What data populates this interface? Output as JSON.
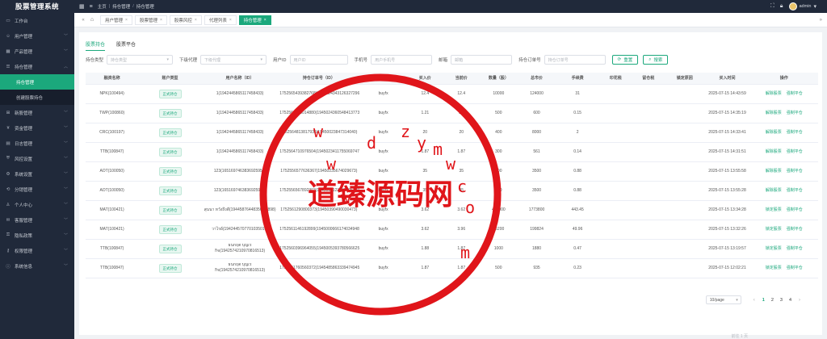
{
  "app": {
    "title": "股票管理系统"
  },
  "topbar": {
    "breadcrumb": [
      "主页",
      "持仓管理",
      "持仓管理"
    ],
    "user": "admin"
  },
  "sidebar": {
    "items": [
      {
        "label": "工作台",
        "icon": "monitor-icon",
        "chevron": false
      },
      {
        "label": "用户管理",
        "icon": "user-icon",
        "chevron": true
      },
      {
        "label": "产品管理",
        "icon": "grid-icon",
        "chevron": true
      },
      {
        "label": "持仓管理",
        "icon": "list-icon",
        "chevron": true,
        "expanded": true
      }
    ],
    "sub_items": [
      {
        "label": "持仓管理",
        "active": true
      },
      {
        "label": "创建股票持仓",
        "active": false
      }
    ],
    "items_after": [
      {
        "label": "新股管理",
        "icon": "plus-square-icon"
      },
      {
        "label": "资金管理",
        "icon": "money-icon"
      },
      {
        "label": "日志管理",
        "icon": "doc-icon"
      },
      {
        "label": "风控设置",
        "icon": "shield-icon"
      },
      {
        "label": "系统设置",
        "icon": "gear-icon"
      },
      {
        "label": "分销管理",
        "icon": "share-icon"
      },
      {
        "label": "个人中心",
        "icon": "person-icon"
      },
      {
        "label": "客服管理",
        "icon": "chat-icon"
      },
      {
        "label": "隐私政策",
        "icon": "lock-icon"
      },
      {
        "label": "权限管理",
        "icon": "key-icon"
      },
      {
        "label": "系统信息",
        "icon": "info-icon"
      }
    ]
  },
  "tabs": [
    {
      "label": "用户管理",
      "active": false
    },
    {
      "label": "股票管理",
      "active": false
    },
    {
      "label": "股票风控",
      "active": false
    },
    {
      "label": "代理列表",
      "active": false
    },
    {
      "label": "持仓管理",
      "active": true
    }
  ],
  "subtabs": [
    {
      "label": "股票持仓",
      "active": true
    },
    {
      "label": "股票平仓",
      "active": false
    }
  ],
  "filters": [
    {
      "label": "持仓类型",
      "placeholder": "持仓类型",
      "select": true,
      "width": 82
    },
    {
      "label": "下级代理",
      "placeholder": "下级代理",
      "select": true,
      "width": 82
    },
    {
      "label": "用户ID",
      "placeholder": "用户ID",
      "select": false,
      "width": 72
    },
    {
      "label": "手机号",
      "placeholder": "用户手机号",
      "select": false,
      "width": 76
    },
    {
      "label": "邮箱",
      "placeholder": "邮箱",
      "select": false,
      "width": 76
    },
    {
      "label": "持仓订单号",
      "placeholder": "持仓订单号",
      "select": false,
      "width": 76
    }
  ],
  "buttons": {
    "reset": "重置",
    "search": "搜索"
  },
  "table": {
    "headers": [
      "融资名称",
      "账户类型",
      "用户名称（ID）",
      "持仓订单号（ID）",
      "买卖方向",
      "买入价",
      "当前价",
      "数量（股）",
      "总市价",
      "手续费",
      "印花税",
      "留仓税",
      "锁定原因",
      "买入时间",
      "操作"
    ],
    "rows": [
      [
        "NPK(100494)",
        "正式持仓",
        "1(1942445865117458433)",
        "1752565439382768(19450243431263272962)",
        "buyfx",
        "12.4",
        "12.4",
        "10000",
        "124000",
        "31",
        "",
        "",
        "",
        "2025-07-15 14:43:59"
      ],
      [
        "TWP(100860)",
        "正式持仓",
        "1(1942445865117458433)",
        "1752564919014880(19450243605484137730)",
        "buyfx",
        "1.21",
        "1.2",
        "500",
        "600",
        "0.15",
        "",
        "",
        "",
        "2025-07-15 14:35:19"
      ],
      [
        "CRC(100197)",
        "正式持仓",
        "1(1942445865117458433)",
        "1752564813817936(19450023847314040)",
        "buyfx",
        "20",
        "20",
        "400",
        "8000",
        "2",
        "",
        "",
        "",
        "2025-07-15 14:33:41"
      ],
      [
        "TTB(100847)",
        "正式持仓",
        "1(1942445865117458433)",
        "1752564710976504(19450234117550697473)",
        "buyfx",
        "1.87",
        "1.87",
        "300",
        "561",
        "0.14",
        "",
        "",
        "",
        "2025-07-15 14:31:51"
      ],
      [
        "AOT(100050)",
        "正式持仓",
        "123(1651697463836925953)",
        "1752556577636367(19450235674029673)",
        "buyfx",
        "35",
        "35",
        "100",
        "3500",
        "0.88",
        "",
        "",
        "",
        "2025-07-15 13:55:58"
      ],
      [
        "AOT(100050)",
        "正式持仓",
        "123(1651697463836925953)",
        "1752556567892303(19450151235386953809)",
        "buyfx",
        "35",
        "35",
        "100",
        "3500",
        "0.88",
        "",
        "",
        "",
        "2025-07-15 13:55:28"
      ],
      [
        "MAT(100421)",
        "正式持仓",
        "สุนนา หวังถึงดี(19445876448350 24898)",
        "1752561290800373(19450390490030473)",
        "buyfx",
        "3.62",
        "3.62",
        "490000",
        "1773800",
        "443.45",
        "",
        "",
        "",
        "2025-07-15 13:34:28"
      ],
      [
        "MAT(100421)",
        "正式持仓",
        "วาไรย์(1942445707701035010)",
        "1752561146192899(19450006661740349487)",
        "buyfx",
        "3.62",
        "3.96",
        "55200",
        "199824",
        "49.96",
        "",
        "",
        "",
        "2025-07-15 13:32:26"
      ],
      [
        "TTB(100847)",
        "正式持仓",
        "ธนกฤต บุญเรกิจ(1942574210970816513)",
        "1752560396964055(1945005393780566625)",
        "buyfx",
        "1.88",
        "1.87",
        "1000",
        "1880",
        "0.47",
        "",
        "",
        "",
        "2025-07-15 13:19:57"
      ],
      [
        "TTB(100847)",
        "正式持仓",
        "ธนกฤต บุญเรกิจ(1942574210970816513)",
        "1752551760560372(1945485863339474945)",
        "buyfx",
        "1.87",
        "1.87",
        "500",
        "935",
        "0.23",
        "",
        "",
        "",
        "2025-07-15 12:02:21"
      ]
    ],
    "ops": [
      "解除股票",
      "强制平仓"
    ],
    "ops_alt": [
      "锁定股票",
      "强制平仓"
    ]
  },
  "pager": {
    "size": "10/page",
    "pages": [
      "1",
      "2",
      "3",
      "4"
    ],
    "active": "1"
  },
  "footer_hint": "前往 1 页",
  "watermark": {
    "main": "道臻源码网",
    "letters": [
      "w",
      "w",
      "w",
      "d",
      "z",
      "y",
      "m",
      "w",
      "c",
      "o",
      "m"
    ]
  },
  "colors": {
    "accent": "#1ba87c",
    "sidebar": "#20293a",
    "watermark": "#e0151a"
  }
}
